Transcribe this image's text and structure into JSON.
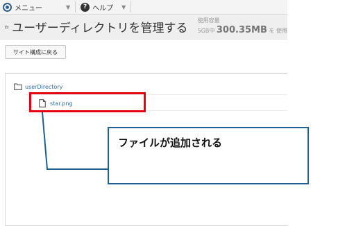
{
  "menubar": {
    "menu_label": "メニュー",
    "help_label": "ヘルプ",
    "help_glyph": "?",
    "caret": "▼"
  },
  "header": {
    "title": "ユーザーディレクトリを管理する",
    "usage_label": "使用容量",
    "usage_quota": "5GB中",
    "usage_amount": "300.35MB",
    "usage_suffix": "を 使用"
  },
  "toolbar": {
    "back_label": "サイト構成に戻る"
  },
  "tree": {
    "directory_name": "userDirectory",
    "files": [
      "star.png"
    ]
  },
  "annotation": {
    "callout_text": "ファイルが追加される",
    "highlight_color": "#e60012",
    "callout_color": "#1f5f95"
  },
  "colors": {
    "link": "#2f6aa5",
    "menu_icon": "#2b5d8f"
  }
}
